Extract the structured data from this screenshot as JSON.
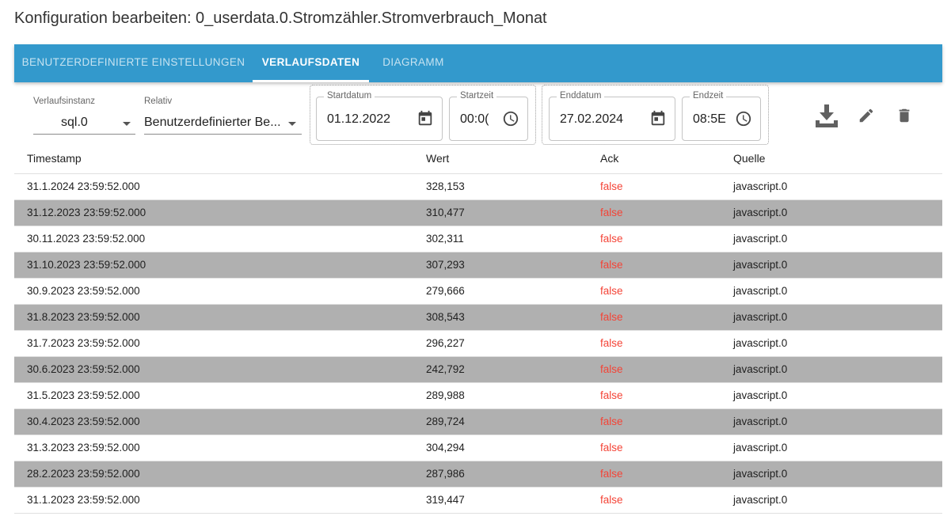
{
  "page_title": "Konfiguration bearbeiten: 0_userdata.0.Stromzähler.Stromverbrauch_Monat",
  "tabs": [
    {
      "label": "Benutzerdefinierte Einstellungen",
      "active": false
    },
    {
      "label": "Verlaufsdaten",
      "active": true
    },
    {
      "label": "Diagramm",
      "active": false
    }
  ],
  "filters": {
    "instance": {
      "label": "Verlaufsinstanz",
      "value": "sql.0"
    },
    "relative": {
      "label": "Relativ",
      "value": "Benutzerdefinierter Be..."
    },
    "start_date": {
      "label": "Startdatum",
      "value": "01.12.2022"
    },
    "start_time": {
      "label": "Startzeit",
      "value": "00:0("
    },
    "end_date": {
      "label": "Enddatum",
      "value": "27.02.2024"
    },
    "end_time": {
      "label": "Endzeit",
      "value": "08:5E"
    }
  },
  "actions": {
    "download_icon": "download-icon",
    "edit_icon": "pencil-icon",
    "delete_icon": "trash-icon"
  },
  "table": {
    "columns": [
      "Timestamp",
      "Wert",
      "Ack",
      "Quelle"
    ],
    "rows": [
      [
        "31.1.2024 23:59:52.000",
        "328,153",
        "false",
        "javascript.0"
      ],
      [
        "31.12.2023 23:59:52.000",
        "310,477",
        "false",
        "javascript.0"
      ],
      [
        "30.11.2023 23:59:52.000",
        "302,311",
        "false",
        "javascript.0"
      ],
      [
        "31.10.2023 23:59:52.000",
        "307,293",
        "false",
        "javascript.0"
      ],
      [
        "30.9.2023 23:59:52.000",
        "279,666",
        "false",
        "javascript.0"
      ],
      [
        "31.8.2023 23:59:52.000",
        "308,543",
        "false",
        "javascript.0"
      ],
      [
        "31.7.2023 23:59:52.000",
        "296,227",
        "false",
        "javascript.0"
      ],
      [
        "30.6.2023 23:59:52.000",
        "242,792",
        "false",
        "javascript.0"
      ],
      [
        "31.5.2023 23:59:52.000",
        "289,988",
        "false",
        "javascript.0"
      ],
      [
        "30.4.2023 23:59:52.000",
        "289,724",
        "false",
        "javascript.0"
      ],
      [
        "31.3.2023 23:59:52.000",
        "304,294",
        "false",
        "javascript.0"
      ],
      [
        "28.2.2023 23:59:52.000",
        "287,986",
        "false",
        "javascript.0"
      ],
      [
        "31.1.2023 23:59:52.000",
        "319,447",
        "false",
        "javascript.0"
      ]
    ]
  },
  "colors": {
    "tab_bar": "#3399cc",
    "striped_row": "#b0b0b0",
    "ack_false": "#f44336"
  }
}
